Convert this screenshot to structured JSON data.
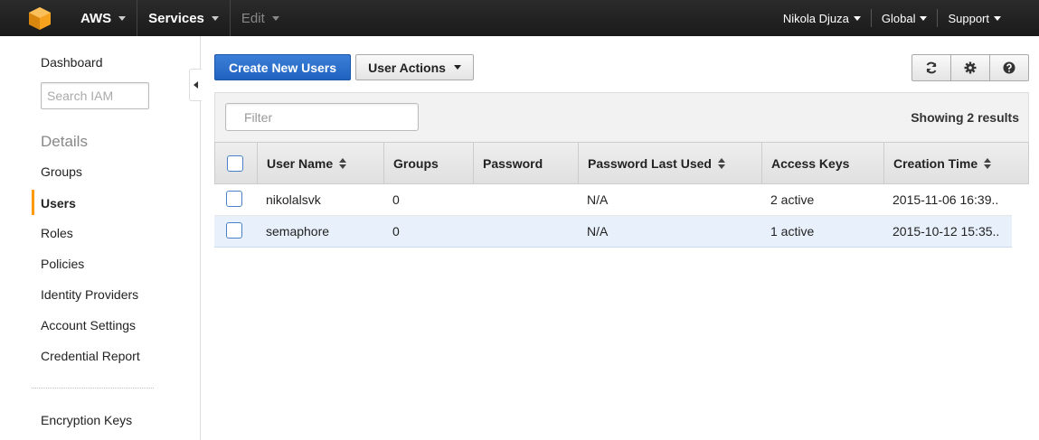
{
  "topbar": {
    "brand": "AWS",
    "services": "Services",
    "edit": "Edit",
    "user": "Nikola Djuza",
    "region": "Global",
    "support": "Support"
  },
  "sidebar": {
    "dashboard": "Dashboard",
    "search_placeholder": "Search IAM",
    "details_heading": "Details",
    "items": [
      "Groups",
      "Users",
      "Roles",
      "Policies",
      "Identity Providers",
      "Account Settings",
      "Credential Report"
    ],
    "active_item": "Users",
    "encryption_keys": "Encryption Keys"
  },
  "toolbar": {
    "create_label": "Create New Users",
    "actions_label": "User Actions",
    "icons": [
      "refresh-icon",
      "gear-icon",
      "help-icon"
    ]
  },
  "filter": {
    "placeholder": "Filter",
    "results": "Showing 2 results"
  },
  "table": {
    "headers": [
      "User Name",
      "Groups",
      "Password",
      "Password Last Used",
      "Access Keys",
      "Creation Time"
    ],
    "rows": [
      {
        "user": "nikolalsvk",
        "groups": "0",
        "password": "",
        "last_used": "N/A",
        "keys": "2 active",
        "created": "2015-11-06 16:39.."
      },
      {
        "user": "semaphore",
        "groups": "0",
        "password": "",
        "last_used": "N/A",
        "keys": "1 active",
        "created": "2015-10-12 15:35.."
      }
    ]
  },
  "colors": {
    "accent_orange": "#ff9900",
    "primary_blue": "#1f63c0",
    "selected_row": "#e8f1fb"
  }
}
